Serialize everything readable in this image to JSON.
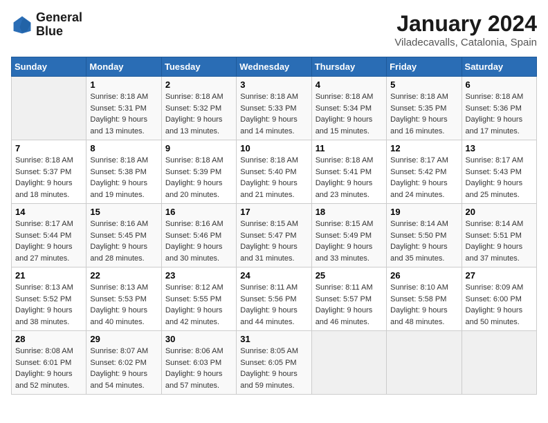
{
  "header": {
    "logo_line1": "General",
    "logo_line2": "Blue",
    "title": "January 2024",
    "subtitle": "Viladecavalls, Catalonia, Spain"
  },
  "columns": [
    "Sunday",
    "Monday",
    "Tuesday",
    "Wednesday",
    "Thursday",
    "Friday",
    "Saturday"
  ],
  "rows": [
    [
      {
        "day": "",
        "sunrise": "",
        "sunset": "",
        "daylight": ""
      },
      {
        "day": "1",
        "sunrise": "Sunrise: 8:18 AM",
        "sunset": "Sunset: 5:31 PM",
        "daylight": "Daylight: 9 hours and 13 minutes."
      },
      {
        "day": "2",
        "sunrise": "Sunrise: 8:18 AM",
        "sunset": "Sunset: 5:32 PM",
        "daylight": "Daylight: 9 hours and 13 minutes."
      },
      {
        "day": "3",
        "sunrise": "Sunrise: 8:18 AM",
        "sunset": "Sunset: 5:33 PM",
        "daylight": "Daylight: 9 hours and 14 minutes."
      },
      {
        "day": "4",
        "sunrise": "Sunrise: 8:18 AM",
        "sunset": "Sunset: 5:34 PM",
        "daylight": "Daylight: 9 hours and 15 minutes."
      },
      {
        "day": "5",
        "sunrise": "Sunrise: 8:18 AM",
        "sunset": "Sunset: 5:35 PM",
        "daylight": "Daylight: 9 hours and 16 minutes."
      },
      {
        "day": "6",
        "sunrise": "Sunrise: 8:18 AM",
        "sunset": "Sunset: 5:36 PM",
        "daylight": "Daylight: 9 hours and 17 minutes."
      }
    ],
    [
      {
        "day": "7",
        "sunrise": "Sunrise: 8:18 AM",
        "sunset": "Sunset: 5:37 PM",
        "daylight": "Daylight: 9 hours and 18 minutes."
      },
      {
        "day": "8",
        "sunrise": "Sunrise: 8:18 AM",
        "sunset": "Sunset: 5:38 PM",
        "daylight": "Daylight: 9 hours and 19 minutes."
      },
      {
        "day": "9",
        "sunrise": "Sunrise: 8:18 AM",
        "sunset": "Sunset: 5:39 PM",
        "daylight": "Daylight: 9 hours and 20 minutes."
      },
      {
        "day": "10",
        "sunrise": "Sunrise: 8:18 AM",
        "sunset": "Sunset: 5:40 PM",
        "daylight": "Daylight: 9 hours and 21 minutes."
      },
      {
        "day": "11",
        "sunrise": "Sunrise: 8:18 AM",
        "sunset": "Sunset: 5:41 PM",
        "daylight": "Daylight: 9 hours and 23 minutes."
      },
      {
        "day": "12",
        "sunrise": "Sunrise: 8:17 AM",
        "sunset": "Sunset: 5:42 PM",
        "daylight": "Daylight: 9 hours and 24 minutes."
      },
      {
        "day": "13",
        "sunrise": "Sunrise: 8:17 AM",
        "sunset": "Sunset: 5:43 PM",
        "daylight": "Daylight: 9 hours and 25 minutes."
      }
    ],
    [
      {
        "day": "14",
        "sunrise": "Sunrise: 8:17 AM",
        "sunset": "Sunset: 5:44 PM",
        "daylight": "Daylight: 9 hours and 27 minutes."
      },
      {
        "day": "15",
        "sunrise": "Sunrise: 8:16 AM",
        "sunset": "Sunset: 5:45 PM",
        "daylight": "Daylight: 9 hours and 28 minutes."
      },
      {
        "day": "16",
        "sunrise": "Sunrise: 8:16 AM",
        "sunset": "Sunset: 5:46 PM",
        "daylight": "Daylight: 9 hours and 30 minutes."
      },
      {
        "day": "17",
        "sunrise": "Sunrise: 8:15 AM",
        "sunset": "Sunset: 5:47 PM",
        "daylight": "Daylight: 9 hours and 31 minutes."
      },
      {
        "day": "18",
        "sunrise": "Sunrise: 8:15 AM",
        "sunset": "Sunset: 5:49 PM",
        "daylight": "Daylight: 9 hours and 33 minutes."
      },
      {
        "day": "19",
        "sunrise": "Sunrise: 8:14 AM",
        "sunset": "Sunset: 5:50 PM",
        "daylight": "Daylight: 9 hours and 35 minutes."
      },
      {
        "day": "20",
        "sunrise": "Sunrise: 8:14 AM",
        "sunset": "Sunset: 5:51 PM",
        "daylight": "Daylight: 9 hours and 37 minutes."
      }
    ],
    [
      {
        "day": "21",
        "sunrise": "Sunrise: 8:13 AM",
        "sunset": "Sunset: 5:52 PM",
        "daylight": "Daylight: 9 hours and 38 minutes."
      },
      {
        "day": "22",
        "sunrise": "Sunrise: 8:13 AM",
        "sunset": "Sunset: 5:53 PM",
        "daylight": "Daylight: 9 hours and 40 minutes."
      },
      {
        "day": "23",
        "sunrise": "Sunrise: 8:12 AM",
        "sunset": "Sunset: 5:55 PM",
        "daylight": "Daylight: 9 hours and 42 minutes."
      },
      {
        "day": "24",
        "sunrise": "Sunrise: 8:11 AM",
        "sunset": "Sunset: 5:56 PM",
        "daylight": "Daylight: 9 hours and 44 minutes."
      },
      {
        "day": "25",
        "sunrise": "Sunrise: 8:11 AM",
        "sunset": "Sunset: 5:57 PM",
        "daylight": "Daylight: 9 hours and 46 minutes."
      },
      {
        "day": "26",
        "sunrise": "Sunrise: 8:10 AM",
        "sunset": "Sunset: 5:58 PM",
        "daylight": "Daylight: 9 hours and 48 minutes."
      },
      {
        "day": "27",
        "sunrise": "Sunrise: 8:09 AM",
        "sunset": "Sunset: 6:00 PM",
        "daylight": "Daylight: 9 hours and 50 minutes."
      }
    ],
    [
      {
        "day": "28",
        "sunrise": "Sunrise: 8:08 AM",
        "sunset": "Sunset: 6:01 PM",
        "daylight": "Daylight: 9 hours and 52 minutes."
      },
      {
        "day": "29",
        "sunrise": "Sunrise: 8:07 AM",
        "sunset": "Sunset: 6:02 PM",
        "daylight": "Daylight: 9 hours and 54 minutes."
      },
      {
        "day": "30",
        "sunrise": "Sunrise: 8:06 AM",
        "sunset": "Sunset: 6:03 PM",
        "daylight": "Daylight: 9 hours and 57 minutes."
      },
      {
        "day": "31",
        "sunrise": "Sunrise: 8:05 AM",
        "sunset": "Sunset: 6:05 PM",
        "daylight": "Daylight: 9 hours and 59 minutes."
      },
      {
        "day": "",
        "sunrise": "",
        "sunset": "",
        "daylight": ""
      },
      {
        "day": "",
        "sunrise": "",
        "sunset": "",
        "daylight": ""
      },
      {
        "day": "",
        "sunrise": "",
        "sunset": "",
        "daylight": ""
      }
    ]
  ]
}
